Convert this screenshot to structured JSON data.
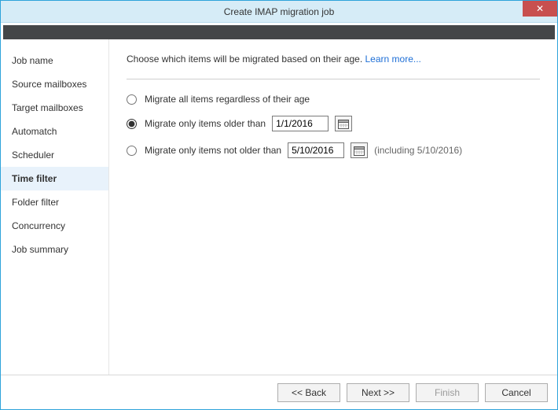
{
  "window": {
    "title": "Create IMAP migration job",
    "close_glyph": "✕"
  },
  "sidebar": {
    "items": [
      {
        "label": "Job name"
      },
      {
        "label": "Source mailboxes"
      },
      {
        "label": "Target mailboxes"
      },
      {
        "label": "Automatch"
      },
      {
        "label": "Scheduler"
      },
      {
        "label": "Time filter"
      },
      {
        "label": "Folder filter"
      },
      {
        "label": "Concurrency"
      },
      {
        "label": "Job summary"
      }
    ],
    "active_index": 5
  },
  "content": {
    "intro_text": "Choose which items will be migrated based on their age. ",
    "learn_more": "Learn more...",
    "options": {
      "opt_all": "Migrate all items regardless of their age",
      "opt_older": "Migrate only items older than",
      "opt_not_older": "Migrate only items not older than",
      "selected": "older",
      "date_older": "1/1/2016",
      "date_not_older": "5/10/2016",
      "including_note": "(including 5/10/2016)"
    }
  },
  "footer": {
    "back": "<< Back",
    "next": "Next >>",
    "finish": "Finish",
    "cancel": "Cancel"
  }
}
